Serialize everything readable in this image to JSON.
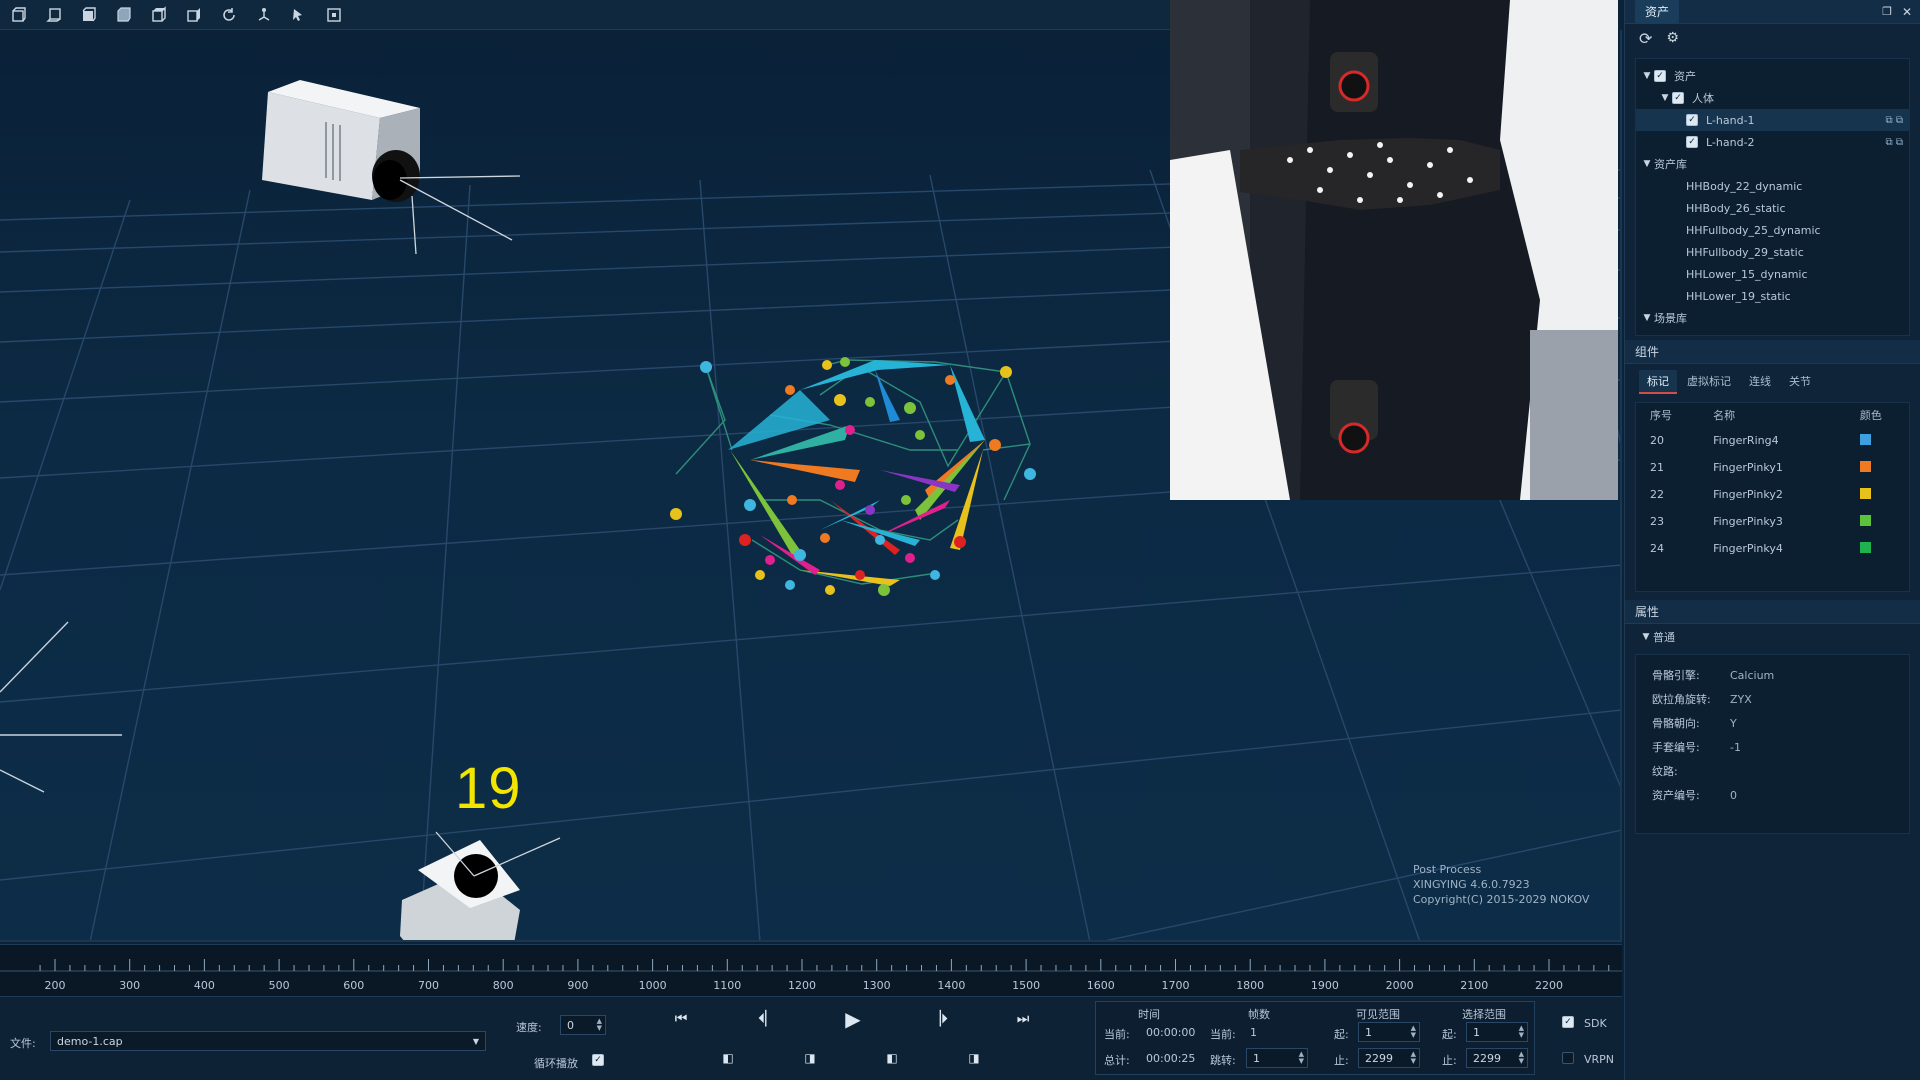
{
  "toolbar": {
    "icons": [
      "view-front-icon",
      "view-back-icon",
      "view-left-icon",
      "view-right-icon",
      "view-top-icon",
      "view-bottom-icon",
      "refresh-view-icon",
      "camera-layout-icon",
      "cursor-select-icon",
      "focus-frame-icon"
    ]
  },
  "viewport": {
    "frame_label": "19",
    "overlay": {
      "line1": "Post Process",
      "line2": "XINGYING 4.6.0.7923",
      "line3": "Copyright(C) 2015-2029 NOKOV"
    }
  },
  "assets_panel": {
    "tab": "资产",
    "tree": {
      "root": "资产",
      "body_group": "人体",
      "items": [
        "L-hand-1",
        "L-hand-2"
      ],
      "library_group": "资产库",
      "library": [
        "HHBody_22_dynamic",
        "HHBody_26_static",
        "HHFullbody_25_dynamic",
        "HHFullbody_29_static",
        "HHLower_15_dynamic",
        "HHLower_19_static"
      ],
      "scene_group": "场景库"
    }
  },
  "components_panel": {
    "title": "组件",
    "tabs": [
      "标记",
      "虚拟标记",
      "连线",
      "关节"
    ],
    "columns": [
      "序号",
      "名称",
      "颜色"
    ],
    "rows": [
      {
        "id": "20",
        "name": "FingerRing4",
        "color": "#3fa0e0"
      },
      {
        "id": "21",
        "name": "FingerPinky1",
        "color": "#f07a22"
      },
      {
        "id": "22",
        "name": "FingerPinky2",
        "color": "#e8c21c"
      },
      {
        "id": "23",
        "name": "FingerPinky3",
        "color": "#5cc23b"
      },
      {
        "id": "24",
        "name": "FingerPinky4",
        "color": "#1fb34f"
      }
    ]
  },
  "properties_panel": {
    "title": "属性",
    "group": "普通",
    "props": [
      {
        "key": "骨骼引擎:",
        "value": "Calcium"
      },
      {
        "key": "欧拉角旋转:",
        "value": "ZYX"
      },
      {
        "key": "骨骼朝向:",
        "value": "Y"
      },
      {
        "key": "手套编号:",
        "value": "-1"
      },
      {
        "key": "纹路:",
        "value": ""
      },
      {
        "key": "资产编号:",
        "value": "0"
      }
    ]
  },
  "timeline": {
    "ticks": [
      "200",
      "300",
      "400",
      "500",
      "600",
      "700",
      "800",
      "900",
      "1000",
      "1100",
      "1200",
      "1300",
      "1400",
      "1500",
      "1600",
      "1700",
      "1800",
      "1900",
      "2000",
      "2100",
      "2200"
    ]
  },
  "bottombar": {
    "file_label": "文件:",
    "file_value": "demo-1.cap",
    "speed_label": "速度:",
    "speed_value": "0",
    "loop_label": "循环播放",
    "range": {
      "col_time": "时间",
      "col_frame": "帧数",
      "col_visible": "可见范围",
      "col_select": "选择范围",
      "current_label": "当前:",
      "current_time": "00:00:00",
      "current_frame_label": "当前:",
      "current_frame": "1",
      "total_label": "总计:",
      "total_time": "00:00:25",
      "total_frame_label": "跳转:",
      "jump_frame": "1",
      "visible_start_label": "起:",
      "visible_start": "1",
      "visible_end_label": "止:",
      "visible_end": "2299",
      "select_start_label": "起:",
      "select_start": "1",
      "select_end_label": "止:",
      "select_end": "2299"
    },
    "sdk_label": "SDK",
    "vrpn_label": "VRPN"
  }
}
